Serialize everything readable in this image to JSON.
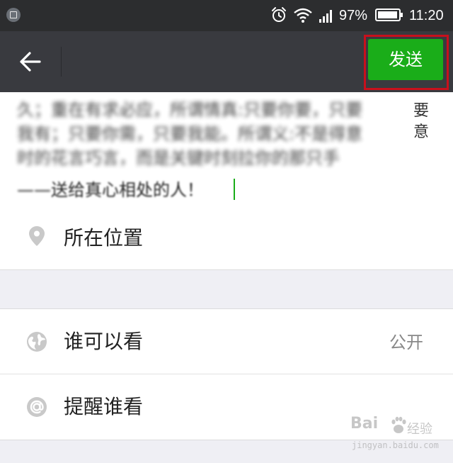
{
  "status_bar": {
    "icons": [
      "gallery-icon",
      "alarm-icon",
      "wifi-icon",
      "signal-icon",
      "battery-icon"
    ],
    "battery_percent": "97%",
    "battery_level": 0.97,
    "time": "11:20"
  },
  "title_bar": {
    "back_icon": "back-arrow-icon",
    "send_label": "发送",
    "send_color": "#1aad19",
    "highlight_color": "#c8101c"
  },
  "post": {
    "lines": [
      "久；重在有求必应，所谓情真:只要你要，只要",
      "我有；只要你需，只要我能。所谓义:不是得意",
      "时的花言巧言，而是关键时刻拉你的那只手"
    ],
    "right_edge": "要意",
    "last_dash": "——",
    "last_tail": "送给真心相处的人！"
  },
  "rows": {
    "location": {
      "icon": "location-pin-icon",
      "label": "所在位置"
    },
    "visibility": {
      "icon": "globe-icon",
      "label": "谁可以看",
      "value": "公开"
    },
    "remind": {
      "icon": "at-sign-icon",
      "label": "提醒谁看"
    }
  },
  "watermark": {
    "brand": "Bai",
    "sub": "经验",
    "url": "jingyan.baidu.com"
  }
}
